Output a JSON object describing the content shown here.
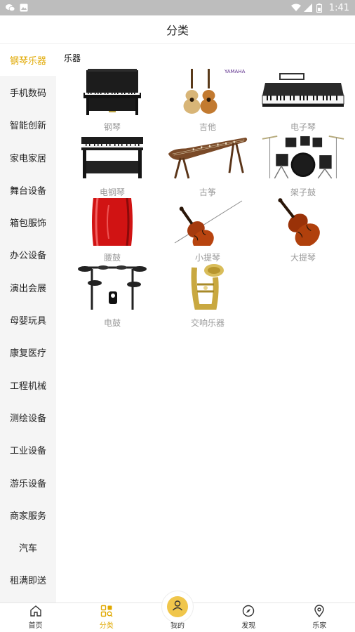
{
  "status_bar": {
    "time": "1:41",
    "icons": [
      "wechat-icon",
      "image-icon",
      "wifi-icon",
      "signal-icon",
      "battery-icon"
    ]
  },
  "header": {
    "title": "分类"
  },
  "sidebar": {
    "items": [
      {
        "label": "钢琴乐器",
        "active": true
      },
      {
        "label": "手机数码"
      },
      {
        "label": "智能创新"
      },
      {
        "label": "家电家居"
      },
      {
        "label": "舞台设备"
      },
      {
        "label": "箱包服饰"
      },
      {
        "label": "办公设备"
      },
      {
        "label": "演出会展"
      },
      {
        "label": "母婴玩具"
      },
      {
        "label": "康复医疗"
      },
      {
        "label": "工程机械"
      },
      {
        "label": "测绘设备"
      },
      {
        "label": "工业设备"
      },
      {
        "label": "游乐设备"
      },
      {
        "label": "商家服务"
      },
      {
        "label": "汽车"
      },
      {
        "label": "租满即送"
      }
    ]
  },
  "content": {
    "section_title": "乐器",
    "brand_logo_text": "YAMAHA",
    "products": [
      {
        "label": "钢琴",
        "icon": "upright-piano"
      },
      {
        "label": "吉他",
        "icon": "guitar"
      },
      {
        "label": "电子琴",
        "icon": "keyboard"
      },
      {
        "label": "电钢琴",
        "icon": "digital-piano"
      },
      {
        "label": "古筝",
        "icon": "guzheng"
      },
      {
        "label": "架子鼓",
        "icon": "drum-kit"
      },
      {
        "label": "腰鼓",
        "icon": "waist-drum"
      },
      {
        "label": "小提琴",
        "icon": "violin"
      },
      {
        "label": "大提琴",
        "icon": "cello"
      },
      {
        "label": "电鼓",
        "icon": "electronic-drum"
      },
      {
        "label": "交响乐器",
        "icon": "tuba"
      }
    ]
  },
  "bottom_nav": {
    "items": [
      {
        "label": "首页",
        "icon": "home-icon"
      },
      {
        "label": "分类",
        "icon": "category-icon",
        "active": true
      },
      {
        "label": "我的",
        "icon": "user-icon"
      },
      {
        "label": "发现",
        "icon": "compass-icon"
      },
      {
        "label": "乐家",
        "icon": "location-icon"
      }
    ]
  },
  "colors": {
    "accent": "#e0a800",
    "sidebar_bg": "#f5f5f5",
    "status_bar": "#bdbdbd"
  }
}
